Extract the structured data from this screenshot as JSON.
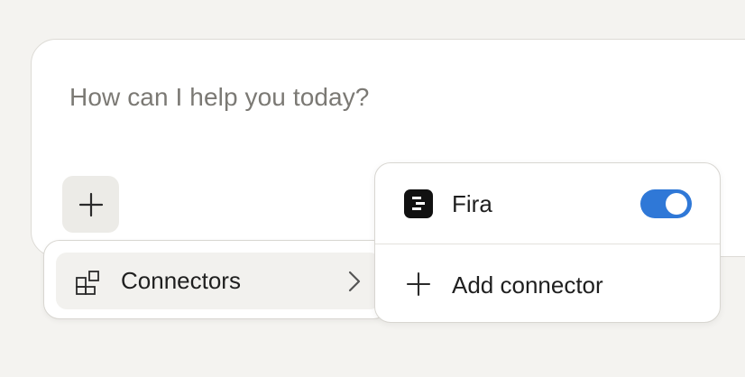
{
  "composer": {
    "placeholder": "How can I help you today?"
  },
  "menu": {
    "connectors_label": "Connectors"
  },
  "connectors_submenu": {
    "items": [
      {
        "label": "Fira",
        "enabled": true,
        "toggle_color": "#2f78d7"
      }
    ],
    "add_label": "Add connector"
  },
  "icons": {
    "composer_action": "plus-icon",
    "connectors": "connectors-icon",
    "connectors_chevron": "chevron-right-icon",
    "fira_logo": "fira-logo-icon",
    "add": "plus-icon"
  },
  "colors": {
    "background": "#f4f3f0",
    "surface": "#ffffff",
    "hover": "#f2f1ee",
    "accent": "#2f78d7",
    "text": "#1f1f1f",
    "placeholder": "#7b7974"
  }
}
